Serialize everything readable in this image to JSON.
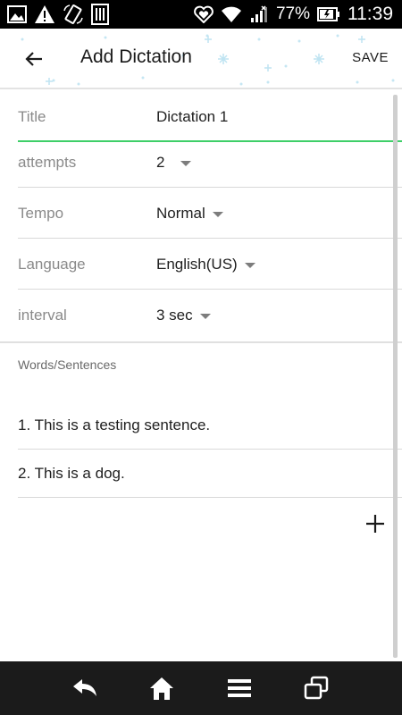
{
  "status_bar": {
    "battery_text": "77%",
    "time": "11:39",
    "icons": [
      "image-icon",
      "warning-icon",
      "rotate-icon",
      "sim-icon",
      "heart-status-icon",
      "wifi-icon",
      "signal-icon",
      "battery-icon"
    ]
  },
  "app_bar": {
    "title": "Add Dictation",
    "save_label": "SAVE"
  },
  "form": {
    "title": {
      "label": "Title",
      "value": "Dictation 1"
    },
    "attempts": {
      "label": "attempts",
      "value": "2"
    },
    "tempo": {
      "label": "Tempo",
      "value": "Normal"
    },
    "language": {
      "label": "Language",
      "value": "English(US)"
    },
    "interval": {
      "label": "interval",
      "value": "3 sec"
    }
  },
  "words": {
    "section_label": "Words/Sentences",
    "items": [
      "1. This is a testing sentence.",
      "2. This is a dog."
    ]
  },
  "colors": {
    "accent_underline": "#3ecf68",
    "status_bar_bg": "#000000",
    "nav_bar_bg": "#1b1b1b"
  },
  "nav_bar": {
    "icons": [
      "back-icon",
      "home-icon",
      "menu-icon",
      "recent-apps-icon"
    ]
  }
}
